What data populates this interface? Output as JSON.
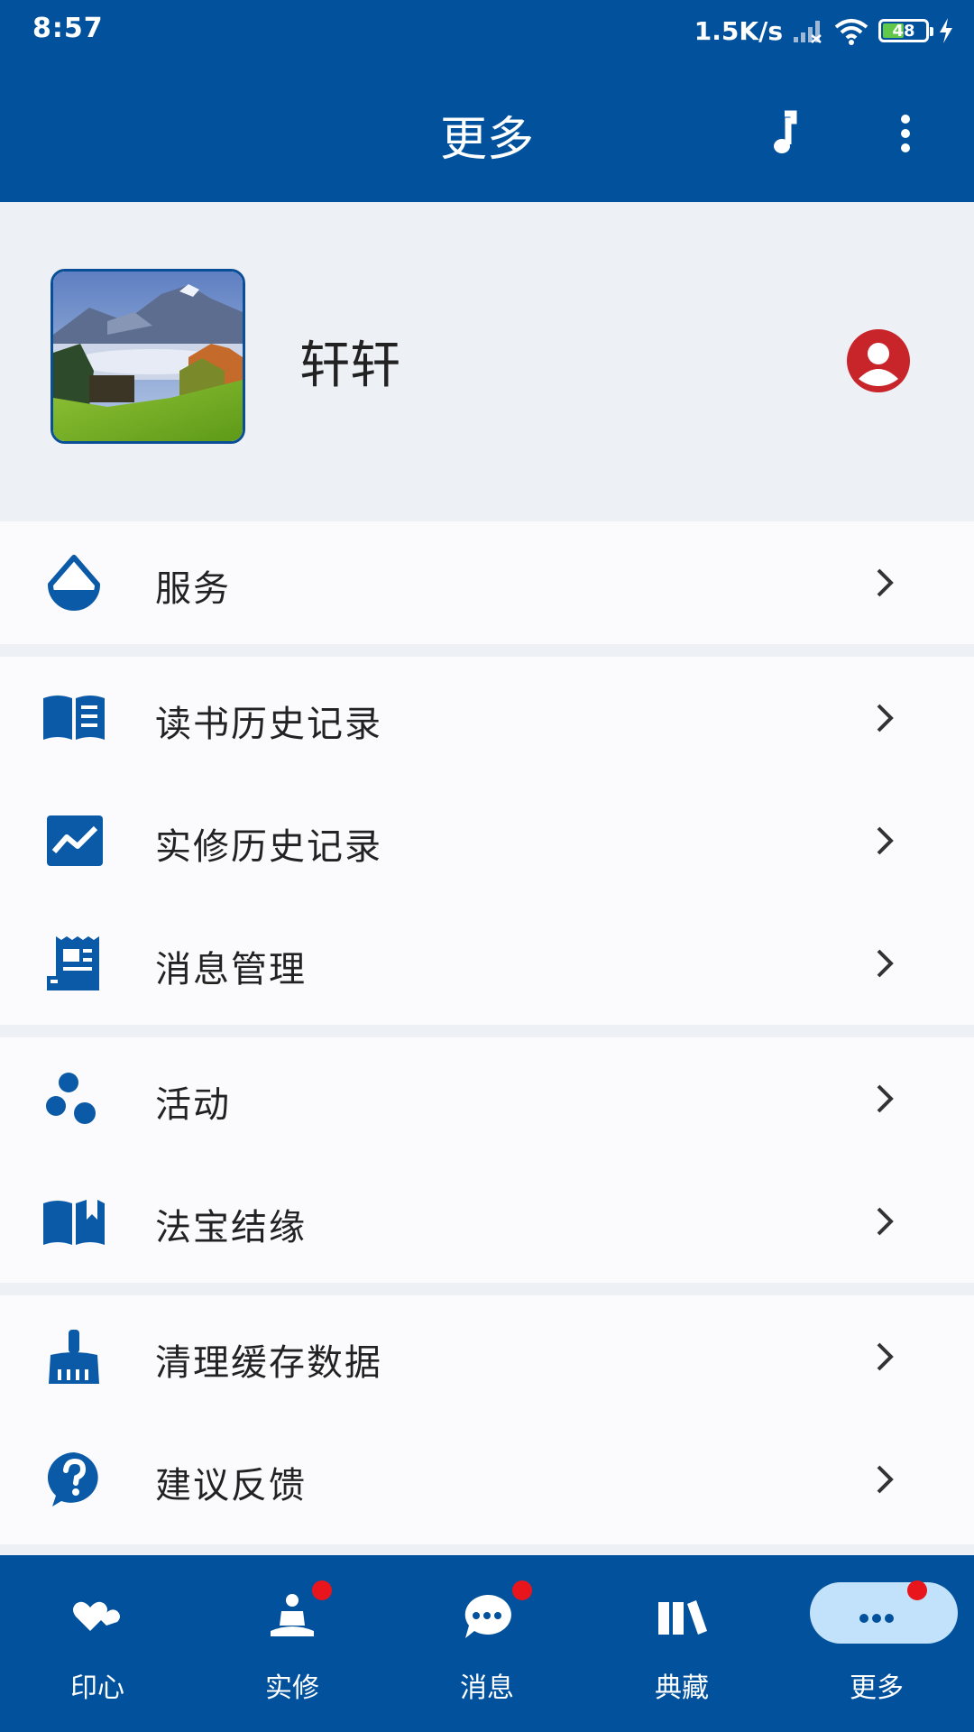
{
  "status_bar": {
    "time": "8:57",
    "speed": "1.5K/s",
    "battery": "48"
  },
  "app_bar": {
    "title": "更多",
    "music_icon": "music-note-icon",
    "more_icon": "more-vertical-icon"
  },
  "profile": {
    "username": "轩轩",
    "avatar": "mountain-landscape-avatar",
    "profile_icon": "user-circle-icon"
  },
  "menu": {
    "service": "服务",
    "reading_history": "读书历史记录",
    "practice_history": "实修历史记录",
    "message_management": "消息管理",
    "activities": "活动",
    "dharma_treasure": "法宝结缘",
    "clear_cache": "清理缓存数据",
    "feedback": "建议反馈"
  },
  "tabs": {
    "yinxin": "印心",
    "shixiu": "实修",
    "xiaoxi": "消息",
    "diancang": "典藏",
    "gengduo": "更多"
  },
  "colors": {
    "primary": "#02519d",
    "background": "#edf0f5",
    "accent_red": "#c8252a",
    "badge": "#e8151c",
    "active_tab": "#c2e1fb"
  }
}
